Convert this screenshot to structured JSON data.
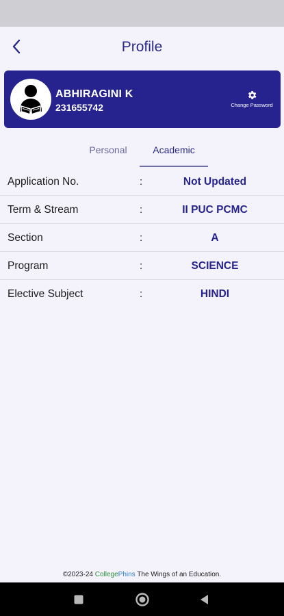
{
  "header": {
    "title": "Profile",
    "back_icon": "chevron-left-icon"
  },
  "profile": {
    "name": "ABHIRAGINI K",
    "id": "231655742",
    "avatar_icon": "student-reading-icon",
    "change_password_label": "Change Password",
    "change_password_icon": "gear-icon"
  },
  "tabs": {
    "personal": "Personal",
    "academic": "Academic",
    "active": "Academic"
  },
  "academic": {
    "separator": ":",
    "rows": [
      {
        "label": "Application No.",
        "value": "Not Updated"
      },
      {
        "label": "Term & Stream",
        "value": "II PUC PCMC"
      },
      {
        "label": "Section",
        "value": "A"
      },
      {
        "label": "Program",
        "value": "SCIENCE"
      },
      {
        "label": "Elective Subject",
        "value": "HINDI"
      }
    ]
  },
  "footer": {
    "prefix": "©2023-24 ",
    "brand_college": "College",
    "brand_phins": "Phins",
    "tagline": " The Wings of an Education."
  },
  "colors": {
    "primary": "#26238e",
    "background": "#f4f3fb",
    "brand_green": "#2e8b3a",
    "brand_blue": "#2f7fd0"
  }
}
